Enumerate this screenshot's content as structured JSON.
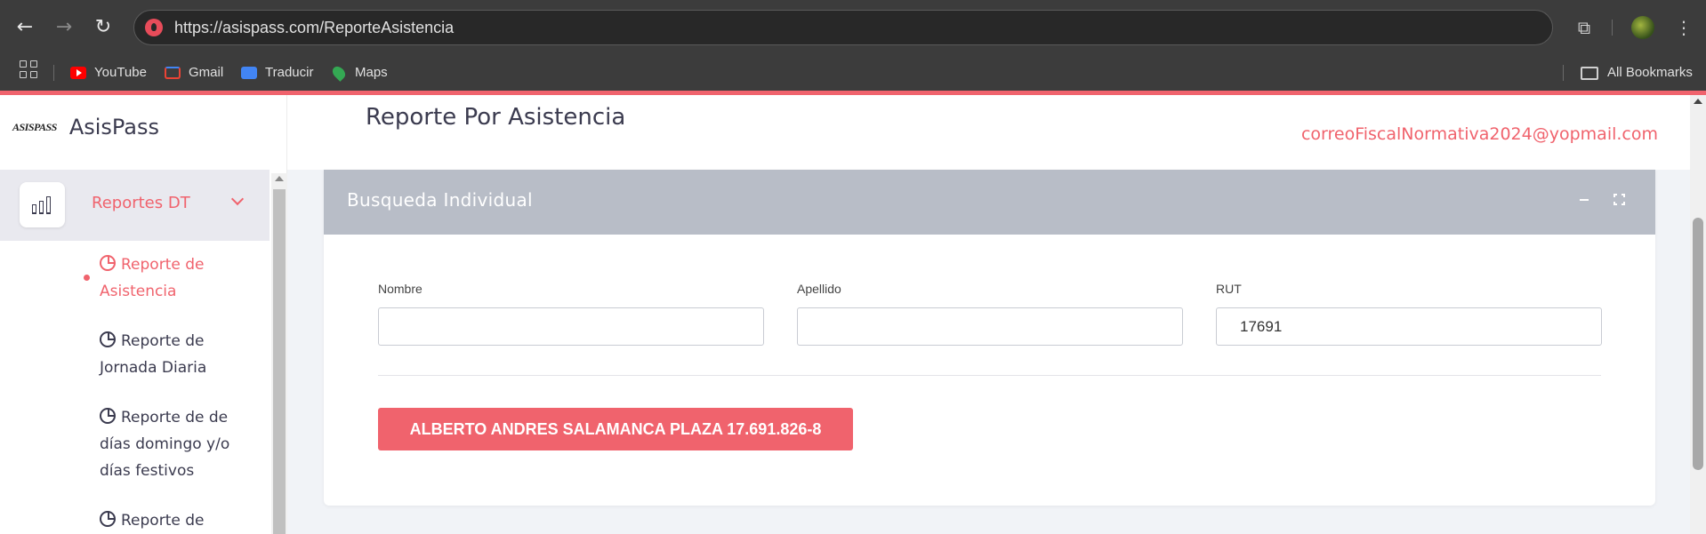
{
  "browser": {
    "url": "https://asispass.com/ReporteAsistencia",
    "bookmarks": [
      "YouTube",
      "Gmail",
      "Traducir",
      "Maps"
    ],
    "all_bookmarks": "All Bookmarks"
  },
  "sidebar": {
    "brand_logo": "ASISPASS",
    "brand_name": "AsisPass",
    "section_label": "Reportes DT",
    "items": [
      {
        "label": "Reporte de Asistencia"
      },
      {
        "label": "Reporte de Jornada Diaria"
      },
      {
        "label": "Reporte de de días domingo y/o días festivos"
      },
      {
        "label": "Reporte de"
      }
    ]
  },
  "header": {
    "title": "Reporte Por Asistencia",
    "user_email": "correoFiscalNormativa2024@yopmail.com"
  },
  "card": {
    "title": "Busqueda Individual",
    "fields": [
      {
        "label": "Nombre",
        "value": ""
      },
      {
        "label": "Apellido",
        "value": ""
      },
      {
        "label": "RUT",
        "value": "17691"
      }
    ],
    "result_button": "ALBERTO ANDRES SALAMANCA PLAZA 17.691.826-8"
  },
  "colors": {
    "accent": "#f0636d",
    "card_header": "#b8bdc7",
    "text_dark": "#3b3b4f"
  }
}
